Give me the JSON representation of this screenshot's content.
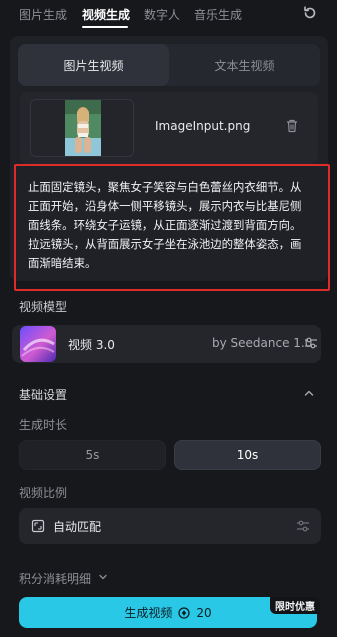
{
  "tabs": [
    {
      "label": "图片生成",
      "active": false
    },
    {
      "label": "视频生成",
      "active": true
    },
    {
      "label": "数字人",
      "active": false
    },
    {
      "label": "音乐生成",
      "active": false
    }
  ],
  "icons": {
    "refresh": "refresh-icon",
    "trash": "trash-icon",
    "settings": "sliders-icon",
    "collapse": "chevron-up-icon",
    "expand": "chevron-down-icon",
    "ratio": "aspect-ratio-icon",
    "credit": "coin-icon"
  },
  "mode": {
    "options": [
      "图片生视频",
      "文本生视频"
    ],
    "selected": "图片生视频"
  },
  "upload": {
    "filename": "ImageInput.png"
  },
  "prompt": {
    "text": "止面固定镜头，聚焦女子笑容与白色蕾丝内衣细节。从正面开始，沿身体一侧平移镜头，展示内衣与比基尼侧面线条。环绕女子运镜，从正面逐渐过渡到背面方向。拉远镜头，从背面展示女子坐在泳池边的整体姿态，画面渐暗结束。"
  },
  "model": {
    "section_label": "视频模型",
    "name": "视频 3.0",
    "provider": "by Seedance 1.0"
  },
  "basic": {
    "section_label": "基础设置",
    "duration_label": "生成时长",
    "durations": [
      "5s",
      "10s"
    ],
    "selected_duration": "10s",
    "ratio_label": "视频比例",
    "ratio_value": "自动匹配"
  },
  "credits": {
    "label": "积分消耗明细"
  },
  "generate": {
    "label": "生成视频",
    "cost": "20",
    "badge": "限时优惠"
  },
  "colors": {
    "accent": "#28c8e6",
    "highlight_border": "#e02b2b",
    "background": "#17181c"
  }
}
